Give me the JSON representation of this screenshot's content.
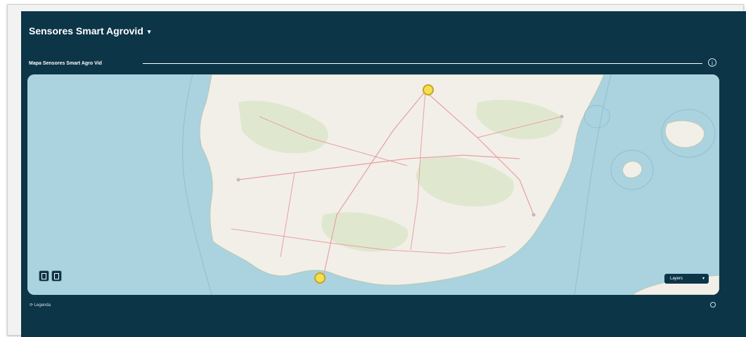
{
  "dashboard": {
    "title": "Sensores Smart Agrovid",
    "title_caret": "▾"
  },
  "widget": {
    "title": "Mapa Sensores Smart Agro Vid",
    "info_icon": "info-circle-icon",
    "info_glyph": "i"
  },
  "map": {
    "layer_select_value": "Layers",
    "layer_select_chevron": "▾",
    "markers": [
      {
        "name": "sensor-marker-north",
        "status_color": "#f4e04d"
      },
      {
        "name": "sensor-marker-south",
        "status_color": "#f4e04d"
      }
    ],
    "colors": {
      "sea": "#aad3df",
      "land": "#f2efe9",
      "road": "#e8a0a0",
      "panel": "#0c3547"
    }
  },
  "footer": {
    "left_label": "⟳ Legenda"
  }
}
